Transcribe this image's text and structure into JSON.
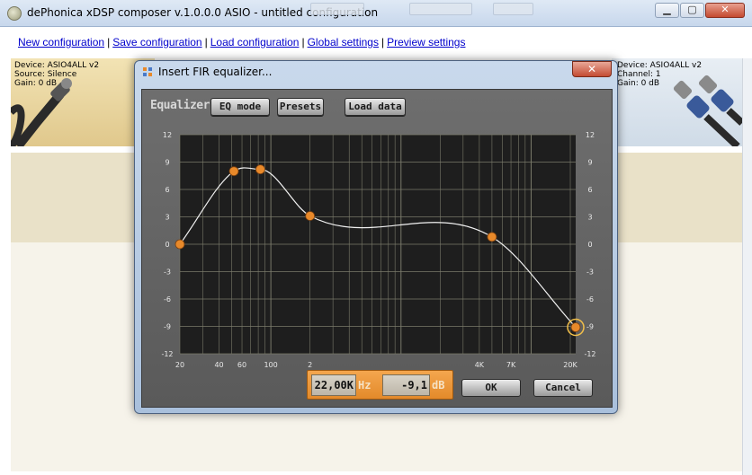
{
  "window": {
    "title": "dePhonica xDSP composer v.1.0.0.0 ASIO - untitled configuration"
  },
  "menu": {
    "items": [
      "New configuration",
      "Save configuration",
      "Load configuration",
      "Global settings",
      "Preview settings"
    ]
  },
  "left_device": {
    "device": "Device: ASIO4ALL v2",
    "source": "Source: Silence",
    "gain": "Gain: 0 dB"
  },
  "right_device": {
    "device": "Device: ASIO4ALL v2",
    "channel": "Channel: 1",
    "gain": "Gain: 0 dB"
  },
  "dialog": {
    "title": "Insert FIR equalizer...",
    "close_glyph": "✕",
    "header": "Equalizer",
    "buttons": {
      "eq_mode": "EQ mode",
      "presets": "Presets",
      "load_data": "Load data",
      "ok": "OK",
      "cancel": "Cancel"
    },
    "readout": {
      "frequency": "22,00K",
      "frequency_unit": "Hz",
      "gain": "-9,1",
      "gain_unit": "dB"
    }
  },
  "chart_data": {
    "type": "line",
    "xscale": "log",
    "xlim": [
      20,
      22000
    ],
    "ylim": [
      -12,
      12
    ],
    "y_ticks": [
      "12",
      "9",
      "6",
      "3",
      "0",
      "-3",
      "-6",
      "-9",
      "-12"
    ],
    "x_ticks": [
      "20",
      "40",
      "60",
      "100",
      "2",
      "4K",
      "7K",
      "20K"
    ],
    "grid": true,
    "colors": {
      "background": "#1e1e1e",
      "grid": "#7a7a6a",
      "curve": "#f2f2f2",
      "point": "#e8892a",
      "selected_ring": "#f3c04a"
    },
    "control_points": [
      {
        "freq": 20,
        "gain": 0.0
      },
      {
        "freq": 52,
        "gain": 8.0
      },
      {
        "freq": 83,
        "gain": 8.2
      },
      {
        "freq": 200,
        "gain": 3.1
      },
      {
        "freq": 5000,
        "gain": 0.8
      },
      {
        "freq": 22000,
        "gain": -9.1
      }
    ],
    "selected_point": 5
  }
}
